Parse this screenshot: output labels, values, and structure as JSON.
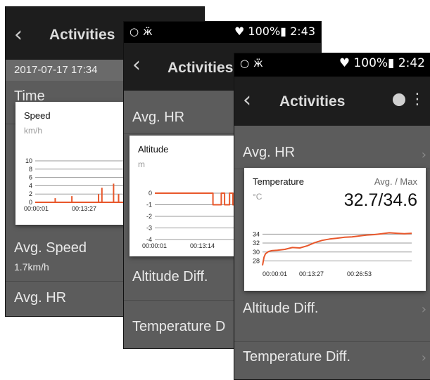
{
  "phones": {
    "speed": {
      "title": "Activities",
      "date": "2017-07-17 17:34",
      "rows": [
        "Time",
        "Avg. Speed",
        "Avg. HR"
      ],
      "speed_value": "1.7km/h",
      "card": {
        "title": "Speed",
        "unit": "km/h"
      }
    },
    "altitude": {
      "status_right": "♥ 100%▮ 2:43",
      "title": "Activities",
      "rows": [
        "Avg. HR",
        "Altitude Diff.",
        "Temperature D"
      ],
      "card": {
        "title": "Altitude",
        "unit": "m"
      }
    },
    "temperature": {
      "status_right": "♥ 100%▮ 2:42",
      "title": "Activities",
      "rows": [
        "Avg. HR",
        "Altitude Diff.",
        "Temperature Diff."
      ],
      "card": {
        "title": "Temperature",
        "unit": "°C",
        "stat_label": "Avg. / Max",
        "stat_value": "32.7/34.6"
      }
    }
  },
  "icons": {
    "back": "chevron-left-icon",
    "target": "target-icon",
    "bug": "bug-icon",
    "location": "location-pin-icon",
    "battery": "battery-icon",
    "sync": "sync-icon",
    "more": "more-vert-icon"
  },
  "chart_data": [
    {
      "type": "bar",
      "title": "Speed",
      "ylabel": "km/h",
      "ylim": [
        0,
        10
      ],
      "yticks": [
        0,
        2,
        4,
        6,
        8,
        10
      ],
      "xticks": [
        "00:00:01",
        "00:13:27"
      ],
      "x": [
        0.12,
        0.22,
        0.38,
        0.4,
        0.47,
        0.5,
        0.56,
        0.6,
        0.64,
        0.72,
        0.76,
        0.82,
        0.88,
        0.94
      ],
      "values": [
        1,
        1.5,
        2,
        3.5,
        4.5,
        2,
        6.5,
        1.5,
        2,
        1,
        3,
        1.5,
        1.5,
        1
      ]
    },
    {
      "type": "line",
      "title": "Altitude",
      "ylabel": "m",
      "ylim": [
        -4,
        0
      ],
      "yticks": [
        0,
        -1,
        -2,
        -3,
        -4
      ],
      "xticks": [
        "00:00:01",
        "00:13:14"
      ],
      "x": [
        0,
        0.35,
        0.35,
        0.4,
        0.4,
        0.42,
        0.42,
        0.45,
        0.45,
        0.47,
        0.47,
        0.5,
        0.5,
        0.55,
        0.55,
        0.57,
        0.57,
        0.63,
        0.63,
        0.68,
        0.68,
        0.72,
        0.72,
        0.76,
        0.76,
        0.78,
        0.78,
        0.82,
        0.82,
        0.86,
        0.86,
        0.9,
        0.9,
        1.0
      ],
      "values": [
        0,
        0,
        -1,
        -1,
        0,
        0,
        -1,
        -1,
        0,
        0,
        -1,
        -1,
        0,
        0,
        -1,
        -1,
        0,
        0,
        -1,
        -1,
        0,
        0,
        -1,
        -1,
        0,
        0,
        -1,
        -1,
        0,
        0,
        -1,
        -1,
        0,
        0
      ]
    },
    {
      "type": "line",
      "title": "Temperature",
      "ylabel": "°C",
      "ylim": [
        26.5,
        35
      ],
      "yticks": [
        28,
        30,
        32,
        34
      ],
      "xticks": [
        "00:00:01",
        "00:13:27",
        "00:26:53"
      ],
      "x": [
        0,
        0.01,
        0.02,
        0.04,
        0.06,
        0.1,
        0.15,
        0.2,
        0.25,
        0.3,
        0.35,
        0.4,
        0.45,
        0.5,
        0.55,
        0.6,
        0.65,
        0.7,
        0.75,
        0.8,
        0.85,
        0.9,
        0.95,
        1.0
      ],
      "values": [
        27,
        28.8,
        29.6,
        30.1,
        30.3,
        30.4,
        30.6,
        31.0,
        30.9,
        31.4,
        32.1,
        32.6,
        32.9,
        33.1,
        33.3,
        33.4,
        33.6,
        33.8,
        33.9,
        34.1,
        34.3,
        34.2,
        34.1,
        34.2
      ]
    }
  ]
}
